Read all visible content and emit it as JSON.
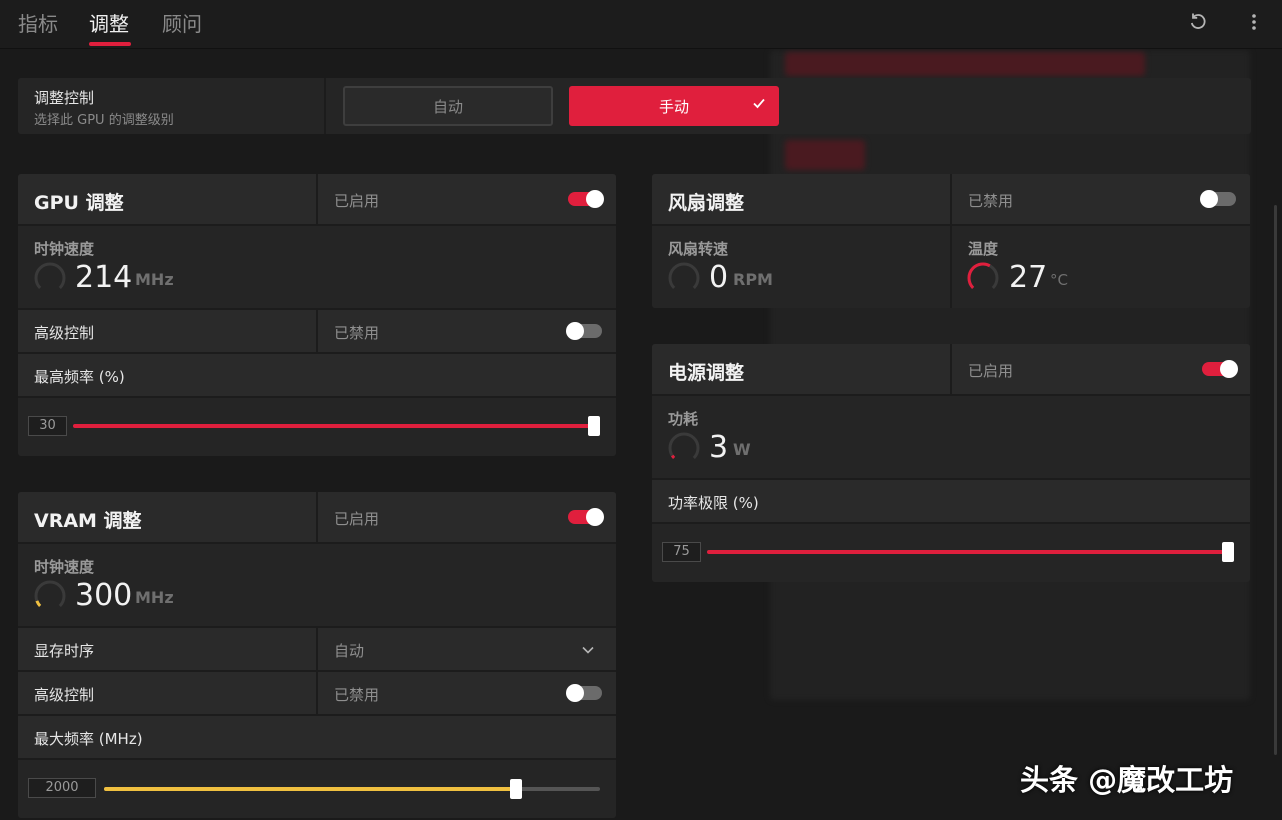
{
  "header": {
    "tabs": [
      "指标",
      "调整",
      "顾问"
    ],
    "active_tab": 1,
    "reset_icon": "reset-icon",
    "menu_icon": "more-vertical-icon"
  },
  "tuning_control": {
    "title": "调整控制",
    "subtitle": "选择此 GPU 的调整级别",
    "auto_label": "自动",
    "manual_label": "手动",
    "selected": "手动"
  },
  "gpu_tuning": {
    "title": "GPU 调整",
    "state": "已启用",
    "enabled": true,
    "clock_label": "时钟速度",
    "clock_value": "214",
    "clock_unit": "MHz",
    "advanced_label": "高级控制",
    "advanced_state": "已禁用",
    "advanced_enabled": false,
    "max_freq_label": "最高频率 (%)",
    "max_freq_value": "30",
    "max_freq_fraction": 1.0
  },
  "vram_tuning": {
    "title": "VRAM 调整",
    "state": "已启用",
    "enabled": true,
    "clock_label": "时钟速度",
    "clock_value": "300",
    "clock_unit": "MHz",
    "timing_label": "显存时序",
    "timing_value": "自动",
    "advanced_label": "高级控制",
    "advanced_state": "已禁用",
    "advanced_enabled": false,
    "max_freq_label": "最大频率 (MHz)",
    "max_freq_value": "2000",
    "max_freq_fraction": 0.83
  },
  "fan_tuning": {
    "title": "风扇调整",
    "state": "已禁用",
    "enabled": false,
    "speed_label": "风扇转速",
    "speed_value": "0",
    "speed_unit": "RPM",
    "temp_label": "温度",
    "temp_value": "27",
    "temp_unit": "°C"
  },
  "power_tuning": {
    "title": "电源调整",
    "state": "已启用",
    "enabled": true,
    "power_label": "功耗",
    "power_value": "3",
    "power_unit": "W",
    "limit_label": "功率极限 (%)",
    "limit_value": "75",
    "limit_fraction": 1.0
  },
  "colors": {
    "accent": "#e01f3d",
    "vram_accent": "#f0c040",
    "panel": "#252525",
    "row": "#2a2a2a"
  },
  "watermark": "头条 @魔改工坊"
}
